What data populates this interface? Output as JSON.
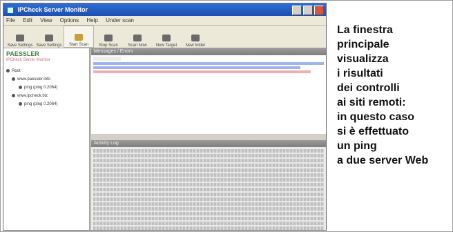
{
  "window": {
    "title": "IPCheck Server Monitor"
  },
  "menu": [
    "File",
    "Edit",
    "View",
    "Options",
    "Help",
    "Under scan"
  ],
  "toolbar": [
    {
      "label": "Save Settings",
      "icon": "folder-icon",
      "active": false
    },
    {
      "label": "Save Settings",
      "icon": "disk-icon",
      "active": false
    },
    {
      "label": "Start Scan",
      "icon": "play-icon",
      "active": true
    },
    {
      "label": "Stop Scan",
      "icon": "stop-icon",
      "active": false
    },
    {
      "label": "Scan Now",
      "icon": "arrow-icon",
      "active": false
    },
    {
      "label": "New Target",
      "icon": "target-icon",
      "active": false
    },
    {
      "label": "New folder",
      "icon": "folder-new-icon",
      "active": false
    }
  ],
  "sidebar": {
    "logo": "PAESSLER",
    "subtitle": "IPCheck Server Monitor",
    "tree": [
      "Root",
      "www.paessler.info",
      "ping (ping 0.2064)",
      "www.ipcheck.biz",
      "ping (ping 0.2064)"
    ]
  },
  "panels": {
    "messages_title": "Messages / Errors",
    "log_title": "Activity Log"
  },
  "caption": [
    "La finestra",
    "principale",
    "visualizza",
    "i risultati",
    "dei controlli",
    "ai siti remoti:",
    "in questo caso",
    "si è effettuato",
    "un ping",
    "a due server Web"
  ],
  "colors": {
    "titlebar": "#1d4fb0",
    "logo": "#3c8a3c",
    "error_text": "#e0747a",
    "info_text": "#3a6adb"
  }
}
